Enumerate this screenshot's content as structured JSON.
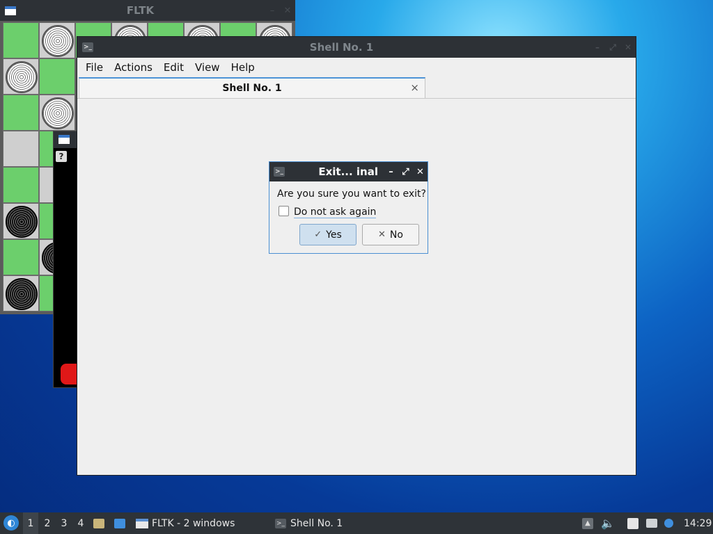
{
  "fltk_window": {
    "title": "FLTK",
    "board": [
      [
        "g",
        "w",
        "g",
        "w",
        "g",
        "w",
        "g",
        "w"
      ],
      [
        "w",
        "g",
        "",
        "",
        "",
        "",
        "",
        ""
      ],
      [
        "g",
        "w",
        "",
        "",
        "",
        "",
        "",
        ""
      ],
      [
        "l",
        "g",
        "",
        "",
        "",
        "",
        "",
        ""
      ],
      [
        "g",
        "l",
        "",
        "",
        "",
        "",
        "",
        ""
      ],
      [
        "b",
        "g",
        "",
        "",
        "",
        "",
        "",
        ""
      ],
      [
        "g",
        "b",
        "",
        "",
        "",
        "",
        "",
        ""
      ],
      [
        "b",
        "g",
        "",
        "",
        "",
        "",
        "",
        ""
      ]
    ],
    "sub_window_button": "?"
  },
  "shell_window": {
    "title": "Shell No. 1",
    "menu": [
      "File",
      "Actions",
      "Edit",
      "View",
      "Help"
    ],
    "tab_label": "Shell No. 1",
    "tab_close": "×"
  },
  "dialog": {
    "title": "Exit...  inal",
    "message": "Are you sure you want to exit?",
    "checkbox_label": "Do not ask again",
    "checkbox_checked": false,
    "yes_label": "Yes",
    "no_label": "No",
    "yes_icon": "✓",
    "no_icon": "✕"
  },
  "taskbar": {
    "workspaces": [
      "1",
      "2",
      "3",
      "4"
    ],
    "active_workspace": "1",
    "tasks": [
      {
        "label": "FLTK - 2 windows",
        "icon": "window-icon"
      },
      {
        "label": "Shell No. 1",
        "icon": "terminal-icon"
      }
    ],
    "clock": "14:29"
  },
  "colors": {
    "accent": "#4c93d6",
    "titlebar": "#2d3136",
    "board_green": "#6ccf6c"
  }
}
